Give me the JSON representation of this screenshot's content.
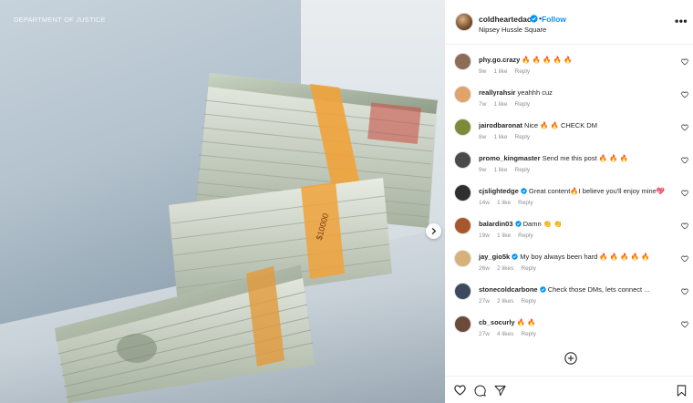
{
  "media": {
    "watermark": "DEPARTMENT OF JUSTICE",
    "next_icon": "chevron-right-icon",
    "band_label": "$10000"
  },
  "header": {
    "username": "coldheartedac",
    "follow_label": "Follow",
    "separator": "•",
    "location": "Nipsey Hussle Square",
    "more_label": "•••"
  },
  "comments": [
    {
      "user": "phy.go.crazy",
      "text": "🔥 🔥 🔥 🔥 🔥",
      "age": "9w",
      "likes": "1 like",
      "reply": "Reply",
      "verified": false,
      "avatar": "#8d6b55"
    },
    {
      "user": "reallyrahsir",
      "text": "yeahhh cuz",
      "age": "7w",
      "likes": "1 like",
      "reply": "Reply",
      "verified": false,
      "avatar": "#e0a46a"
    },
    {
      "user": "jairodbaronat",
      "text": "Nice 🔥 🔥 CHECK DM",
      "age": "8w",
      "likes": "1 like",
      "reply": "Reply",
      "verified": false,
      "avatar": "#7a8c3a"
    },
    {
      "user": "promo_kingmaster",
      "text": "Send me this post 🔥 🔥 🔥",
      "age": "9w",
      "likes": "1 like",
      "reply": "Reply",
      "verified": false,
      "avatar": "#4a4a4a"
    },
    {
      "user": "cjslightedge",
      "text": "Great content🔥I believe you'll enjoy mine💖",
      "age": "14w",
      "likes": "1 like",
      "reply": "Reply",
      "verified": true,
      "avatar": "#2f2f2f"
    },
    {
      "user": "balardin03",
      "text": "Damn 👏 👏",
      "age": "19w",
      "likes": "1 like",
      "reply": "Reply",
      "verified": true,
      "avatar": "#a8562c"
    },
    {
      "user": "jay_gio5k",
      "text": "My boy always been hard 🔥 🔥 🔥 🔥 🔥",
      "age": "26w",
      "likes": "2 likes",
      "reply": "Reply",
      "verified": true,
      "avatar": "#d8b07a"
    },
    {
      "user": "stonecoldcarbone",
      "text": "Check those DMs, lets connect ...",
      "age": "27w",
      "likes": "2 likes",
      "reply": "Reply",
      "verified": true,
      "avatar": "#3b4a5c"
    },
    {
      "user": "cb_socurly",
      "text": "🔥 🔥",
      "age": "27w",
      "likes": "4 likes",
      "reply": "Reply",
      "verified": false,
      "avatar": "#6b4a3a"
    }
  ],
  "icons": {
    "verified": "verified-badge-icon",
    "heart": "heart-icon",
    "load_more": "plus-circle-icon",
    "like": "heart-icon",
    "comment": "comment-icon",
    "share": "share-icon",
    "save": "bookmark-icon"
  },
  "colors": {
    "accent": "#0095f6",
    "meta": "#8e8e8e",
    "band": "#f0a23a"
  }
}
